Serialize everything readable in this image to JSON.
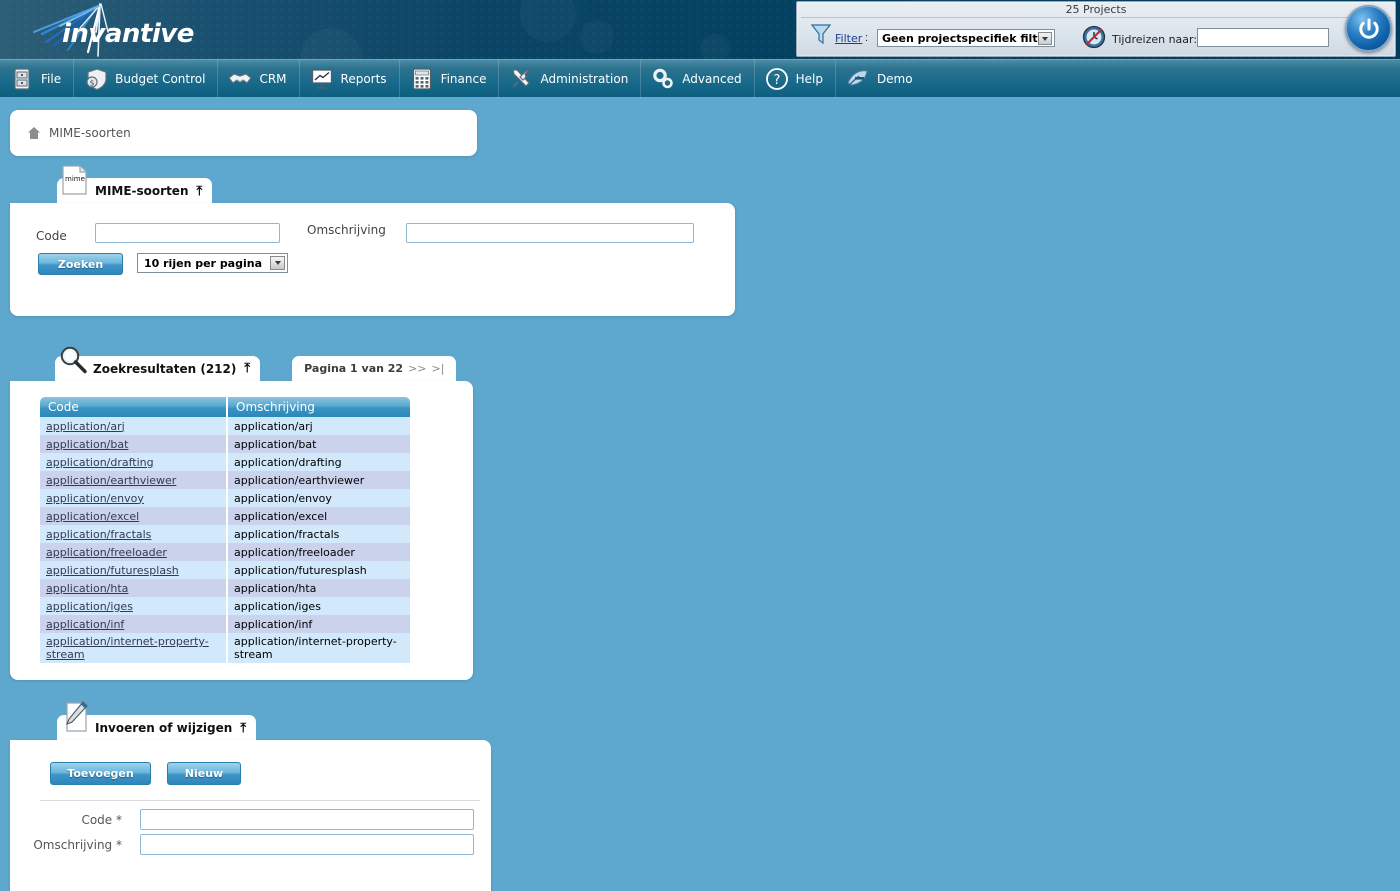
{
  "app": {
    "brand": "invantive",
    "brand_icon": "burst-logo-icon"
  },
  "header": {
    "project_count_label": "25 Projects",
    "filter_link": "Filter",
    "filter_colon": ":",
    "filter_value": "Geen projectspecifiek filter",
    "filter_icon": "funnel-icon",
    "timetravel_label": "Tijdreizen naar:",
    "timetravel_icon": "clock-icon",
    "timetravel_value": "",
    "power_icon": "power-icon"
  },
  "menu": {
    "items": [
      {
        "label": "File",
        "icon": "file-cabinet-icon"
      },
      {
        "label": "Budget Control",
        "icon": "money-shield-icon"
      },
      {
        "label": "CRM",
        "icon": "handshake-icon"
      },
      {
        "label": "Reports",
        "icon": "presentation-chart-icon"
      },
      {
        "label": "Finance",
        "icon": "calculator-icon"
      },
      {
        "label": "Administration",
        "icon": "tools-icon"
      },
      {
        "label": "Advanced",
        "icon": "gears-icon"
      },
      {
        "label": "Help",
        "icon": "question-circle-icon"
      },
      {
        "label": "Demo",
        "icon": "feather-icon"
      }
    ]
  },
  "breadcrumb": {
    "home_icon": "home-icon",
    "text": "MIME-soorten"
  },
  "search_panel": {
    "tab_label": "MIME-soorten",
    "tab_icon": "mime-document-icon",
    "tab_icon_text": "mime",
    "collapse_icon": "chevron-up-icon",
    "code_label": "Code",
    "code_value": "",
    "description_label": "Omschrijving",
    "description_value": "",
    "search_button": "Zoeken",
    "rows_per_page": "10 rijen per pagina"
  },
  "results_panel": {
    "tab_label": "Zoekresultaten (212)",
    "tab_icon": "magnifier-icon",
    "collapse_icon": "chevron-up-icon",
    "page_tab_text": "Pagina 1 van 22",
    "page_next": ">>",
    "page_last": ">|",
    "columns": [
      "Code",
      "Omschrijving"
    ],
    "rows": [
      {
        "code": "application/arj",
        "description": "application/arj"
      },
      {
        "code": "application/bat",
        "description": "application/bat"
      },
      {
        "code": "application/drafting",
        "description": "application/drafting"
      },
      {
        "code": "application/earthviewer",
        "description": "application/earthviewer"
      },
      {
        "code": "application/envoy",
        "description": "application/envoy"
      },
      {
        "code": "application/excel",
        "description": "application/excel"
      },
      {
        "code": "application/fractals",
        "description": "application/fractals"
      },
      {
        "code": "application/freeloader",
        "description": "application/freeloader"
      },
      {
        "code": "application/futuresplash",
        "description": "application/futuresplash"
      },
      {
        "code": "application/hta",
        "description": "application/hta"
      },
      {
        "code": "application/iges",
        "description": "application/iges"
      },
      {
        "code": "application/inf",
        "description": "application/inf"
      },
      {
        "code": "application/internet-property-stream",
        "description": "application/internet-property-stream"
      }
    ]
  },
  "edit_panel": {
    "tab_label": "Invoeren of wijzigen",
    "tab_icon": "pencil-document-icon",
    "collapse_icon": "chevron-up-icon",
    "add_button": "Toevoegen",
    "new_button": "Nieuw",
    "code_label": "Code *",
    "code_value": "",
    "description_label": "Omschrijving *",
    "description_value": ""
  },
  "colors": {
    "page_background": "#5EA7CE",
    "banner_dark": "#013D5C",
    "menu_bar": "#186A8B",
    "accent_blue": "#2F86BB",
    "row_odd": "#D2E8FB",
    "row_even": "#CBD3EC"
  }
}
